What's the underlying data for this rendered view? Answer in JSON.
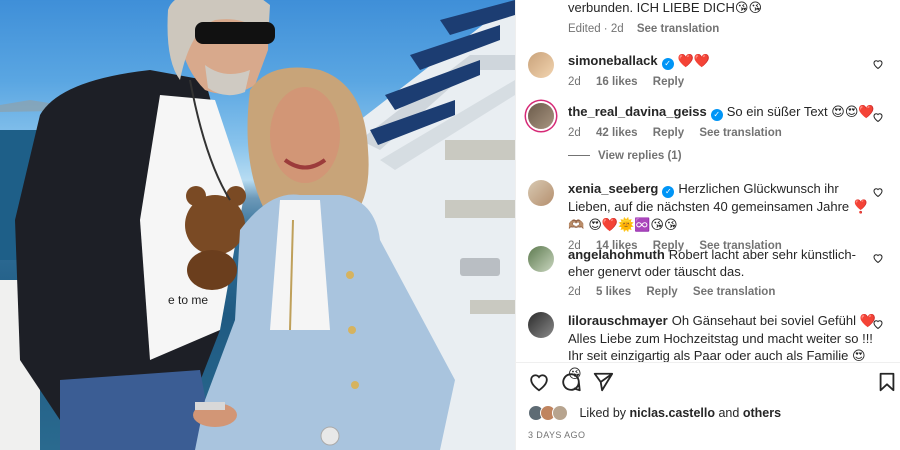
{
  "post": {
    "caption_tail": "verbunden. ICH LIEBE DICH",
    "caption_tail_emoji": "😘😘",
    "caption_meta": {
      "edited": "Edited · 2d",
      "see_translation": "See translation"
    }
  },
  "comments": [
    {
      "username": "simoneballack",
      "verified": true,
      "text": "",
      "emoji": "❤️❤️",
      "time": "2d",
      "likes": "16 likes",
      "reply": "Reply",
      "see_translation": ""
    },
    {
      "username": "the_real_davina_geiss",
      "verified": true,
      "text": "So ein süßer Text",
      "emoji": "😍😍❤️",
      "time": "2d",
      "likes": "42 likes",
      "reply": "Reply",
      "see_translation": "See translation"
    },
    {
      "username": "xenia_seeberg",
      "verified": true,
      "text": "Herzlichen Glückwunsch ihr Lieben, auf die nächsten 40 gemeinsamen Jahre",
      "emoji": "❣️🫶🏽 😍❤️🌞♾️😘😘",
      "time": "2d",
      "likes": "14 likes",
      "reply": "Reply",
      "see_translation": "See translation"
    },
    {
      "username": "angelahohmuth",
      "verified": false,
      "text": "Robert lacht aber sehr künstlich-eher genervt oder täuscht das.",
      "emoji": "",
      "time": "2d",
      "likes": "5 likes",
      "reply": "Reply",
      "see_translation": "See translation"
    },
    {
      "username": "lilorauschmayer",
      "verified": false,
      "text": "Oh Gänsehaut bei soviel Gefühl",
      "text2": "Alles Liebe zum Hochzeitstag und macht weiter so !!! Ihr seit einzigartig als Paar oder auch als Familie",
      "emoji_mid": "❤️",
      "emoji": "😍😘",
      "time": "",
      "likes": "",
      "reply": "",
      "see_translation": ""
    }
  ],
  "view_replies": "View replies (1)",
  "icons": [
    "heart-icon",
    "comment-icon",
    "share-icon",
    "bookmark-icon",
    "verified-badge-icon",
    "like-heart-icon"
  ],
  "liked_by": {
    "prefix": "Liked by",
    "user": "niclas.castello",
    "joiner": "and",
    "others": "others"
  },
  "timestamp": "3 DAYS AGO",
  "colors": {
    "verified": "#0095f6",
    "text": "#262626",
    "secondary": "#737373",
    "story_ring": "#d62976"
  }
}
